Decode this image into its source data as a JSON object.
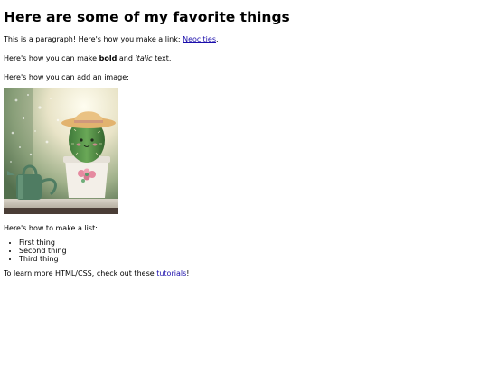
{
  "heading": "Here are some of my favorite things",
  "para1": {
    "before": "This is a paragraph! Here's how you make a link: ",
    "link": "Neocities",
    "after": "."
  },
  "para2": {
    "before": "Here's how you can make ",
    "bold": "bold",
    "middle": " and ",
    "italic": "italic",
    "after": " text."
  },
  "para3": "Here's how you can add an image:",
  "image": {
    "icon": "cactus-photo",
    "alt_desc": ""
  },
  "para4": "Here's how to make a list:",
  "list": [
    "First thing",
    "Second thing",
    "Third thing"
  ],
  "para5": {
    "before": "To learn more HTML/CSS, check out these ",
    "link": "tutorials",
    "after": "!"
  },
  "colors": {
    "link": "#1a0dab",
    "text": "#000000",
    "background": "#ffffff"
  }
}
